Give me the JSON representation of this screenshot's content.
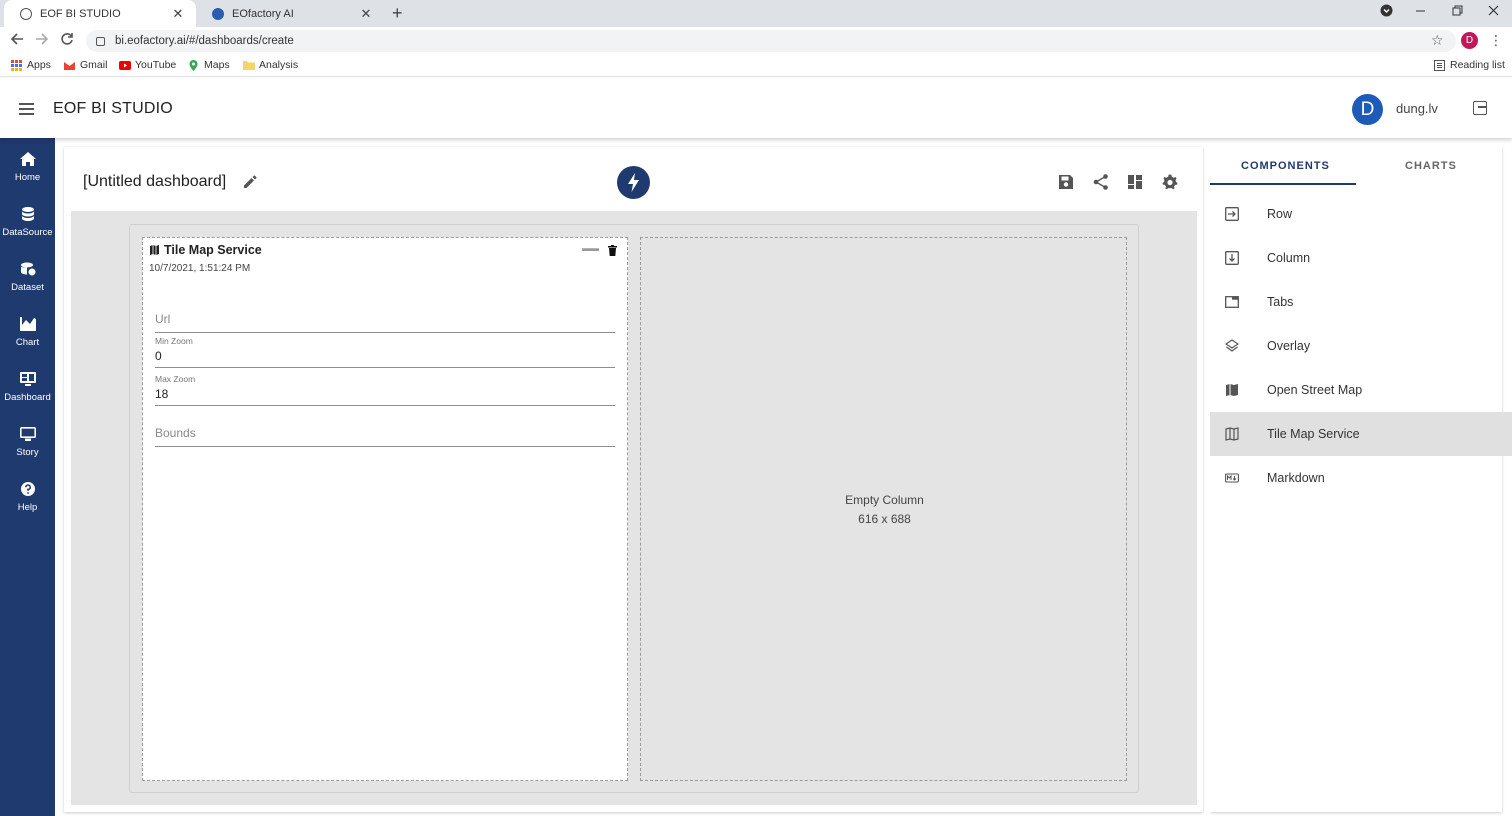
{
  "browser": {
    "tabs": [
      {
        "title": "EOF BI STUDIO",
        "close": "✕"
      },
      {
        "title": "EOfactory AI",
        "close": "✕"
      }
    ],
    "new_tab": "+",
    "url": "bi.eofactory.ai/#/dashboards/create",
    "profile_initial": "D",
    "bookmarks": [
      "Apps",
      "Gmail",
      "YouTube",
      "Maps",
      "Analysis"
    ],
    "reading_list": "Reading list"
  },
  "app": {
    "title": "EOF BI STUDIO",
    "user_initial": "D",
    "username": "dung.lv",
    "accent": "#1f3a6e"
  },
  "sidebar": {
    "items": [
      {
        "label": "Home",
        "icon": "home-icon"
      },
      {
        "label": "DataSource",
        "icon": "database-icon"
      },
      {
        "label": "Dataset",
        "icon": "dataset-icon"
      },
      {
        "label": "Chart",
        "icon": "chart-icon"
      },
      {
        "label": "Dashboard",
        "icon": "dashboard-icon"
      },
      {
        "label": "Story",
        "icon": "story-icon"
      },
      {
        "label": "Help",
        "icon": "help-icon"
      }
    ]
  },
  "dashboard": {
    "title": "[Untitled dashboard]",
    "widget": {
      "title": "Tile Map Service",
      "date": "10/7/2021, 1:51:24 PM",
      "fields": {
        "url_placeholder": "Url",
        "min_zoom_label": "Min Zoom",
        "min_zoom_value": "0",
        "max_zoom_label": "Max Zoom",
        "max_zoom_value": "18",
        "bounds_placeholder": "Bounds"
      }
    },
    "empty_column": {
      "label": "Empty Column",
      "size": "616 x 688"
    }
  },
  "panel": {
    "tabs": [
      "COMPONENTS",
      "CHARTS"
    ],
    "components": [
      {
        "label": "Row",
        "icon": "row-icon"
      },
      {
        "label": "Column",
        "icon": "column-icon"
      },
      {
        "label": "Tabs",
        "icon": "tabs-icon"
      },
      {
        "label": "Overlay",
        "icon": "layers-icon"
      },
      {
        "label": "Open Street Map",
        "icon": "map-filled-icon"
      },
      {
        "label": "Tile Map Service",
        "icon": "map-outline-icon",
        "selected": true
      },
      {
        "label": "Markdown",
        "icon": "markdown-icon"
      }
    ]
  }
}
